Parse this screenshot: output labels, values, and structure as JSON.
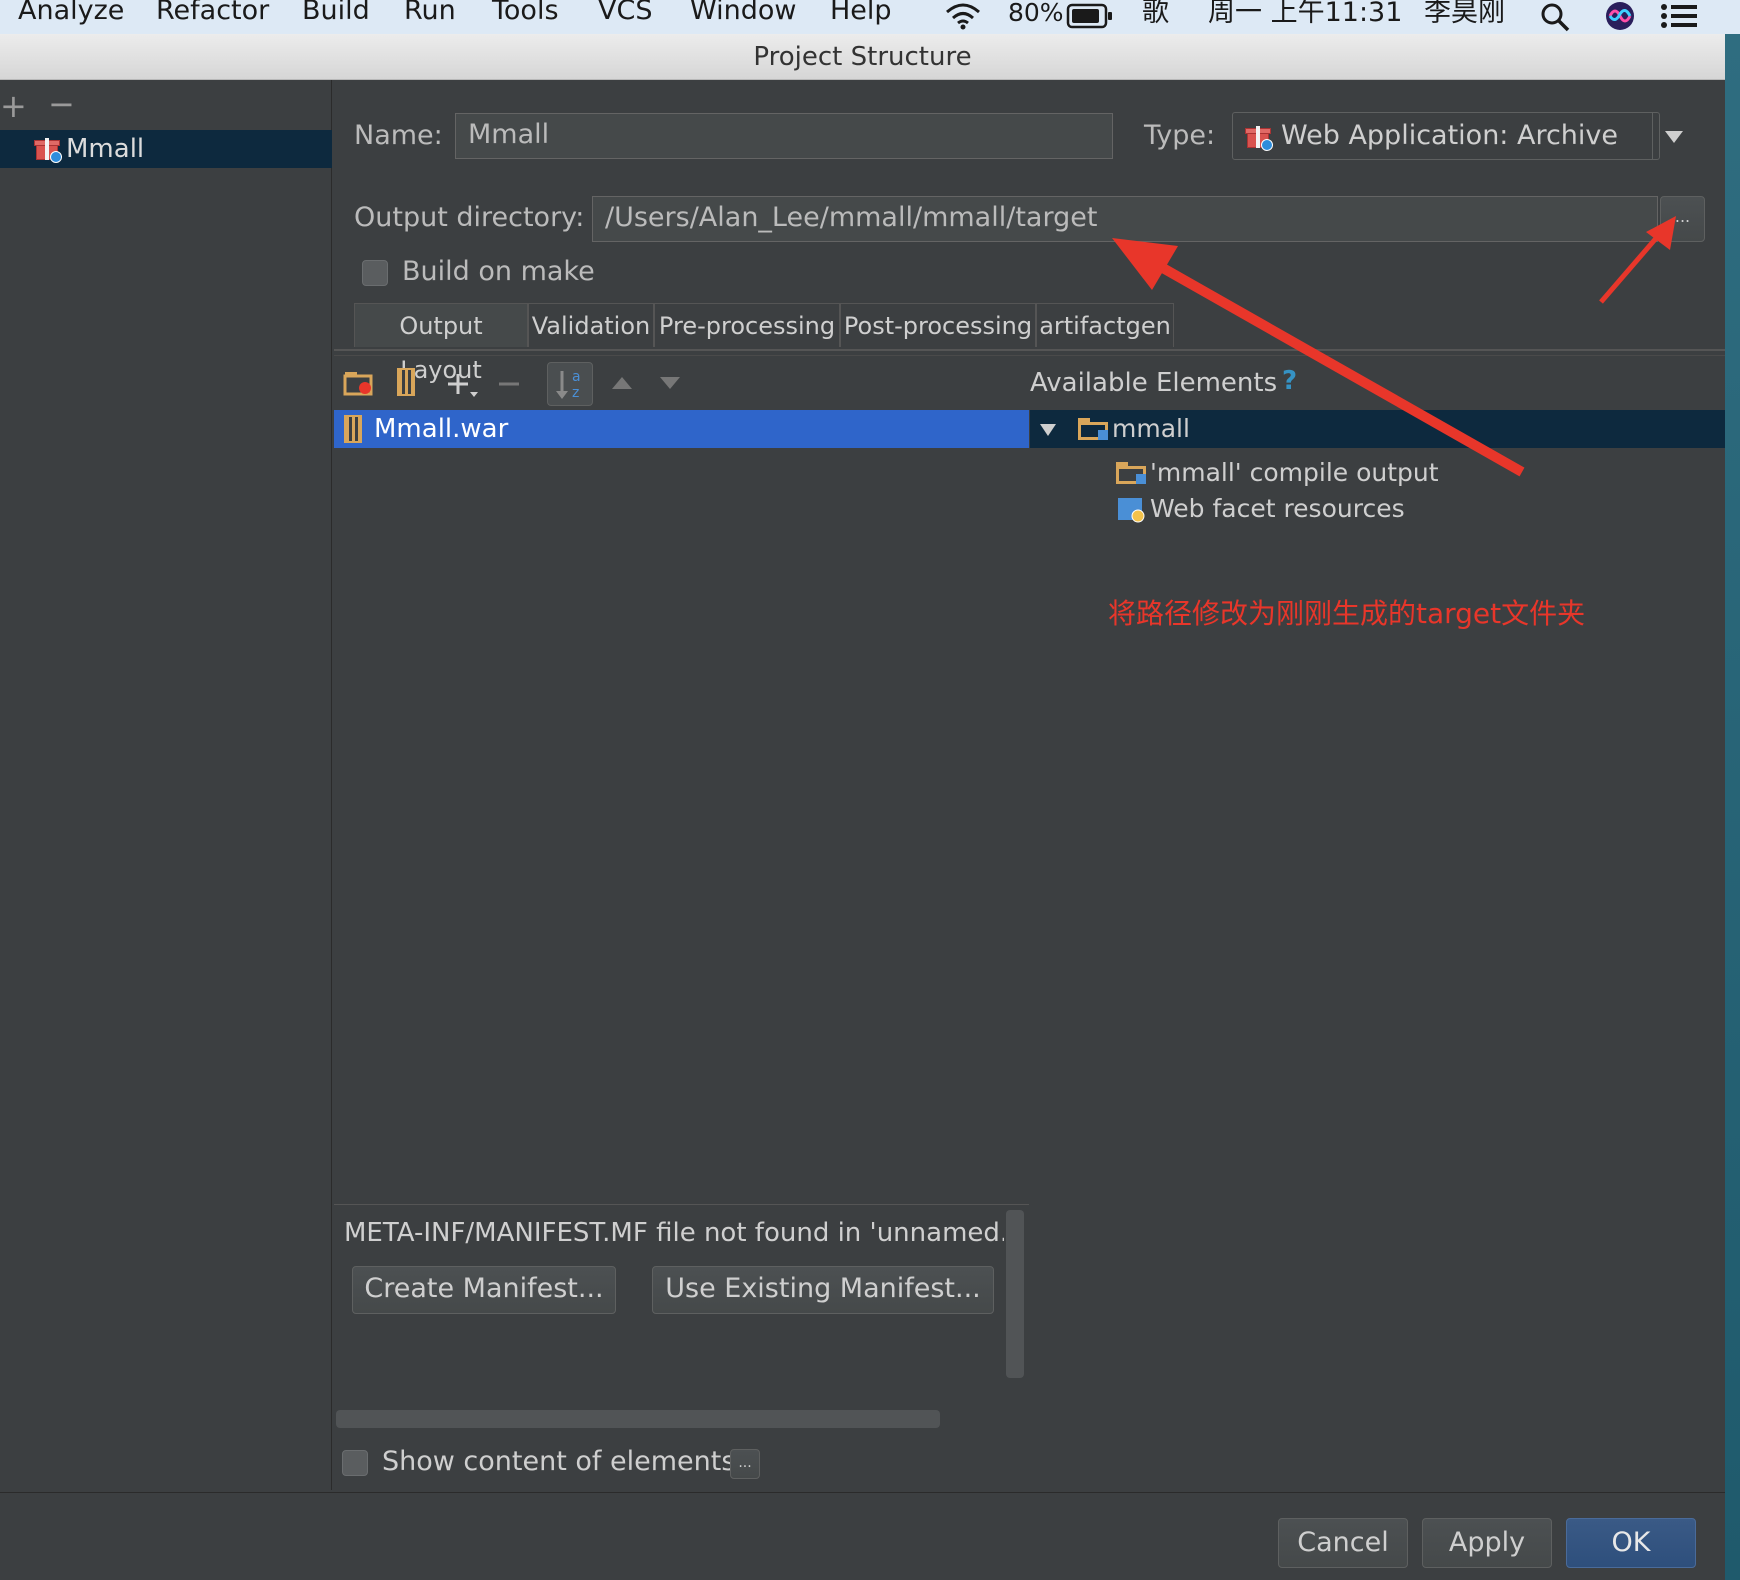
{
  "menubar": {
    "items": [
      "Analyze",
      "Refactor",
      "Build",
      "Run",
      "Tools",
      "VCS",
      "Window",
      "Help"
    ],
    "battery": "80%",
    "input_method": "歌",
    "clock": "周一 上午11:31",
    "user": "李昊刚"
  },
  "window": {
    "title": "Project Structure"
  },
  "sidebar": {
    "add": "+",
    "remove": "−",
    "artifact": "Mmall"
  },
  "form": {
    "name_label": "Name:",
    "name_value": "Mmall",
    "type_label": "Type:",
    "type_value": "Web Application: Archive",
    "output_label": "Output directory:",
    "output_value": "/Users/Alan_Lee/mmall/mmall/target",
    "browse": "...",
    "build_on_make": "Build on make"
  },
  "tabs": [
    "Output Layout",
    "Validation",
    "Pre-processing",
    "Post-processing",
    "artifactgen"
  ],
  "output_layout": {
    "root": "Mmall.war",
    "available_title": "Available Elements",
    "help": "?",
    "available": {
      "module": "mmall",
      "children": [
        "'mmall' compile output",
        "Web facet resources"
      ]
    }
  },
  "annotation": {
    "text": "将路径修改为刚刚生成的target文件夹",
    "color": "#e8362a"
  },
  "manifest": {
    "message": "META-INF/MANIFEST.MF file not found in 'unnamed.",
    "create": "Create Manifest...",
    "use_existing": "Use Existing Manifest..."
  },
  "show_content": {
    "label": "Show content of elements",
    "button": "..."
  },
  "footer": {
    "cancel": "Cancel",
    "apply": "Apply",
    "ok": "OK"
  }
}
